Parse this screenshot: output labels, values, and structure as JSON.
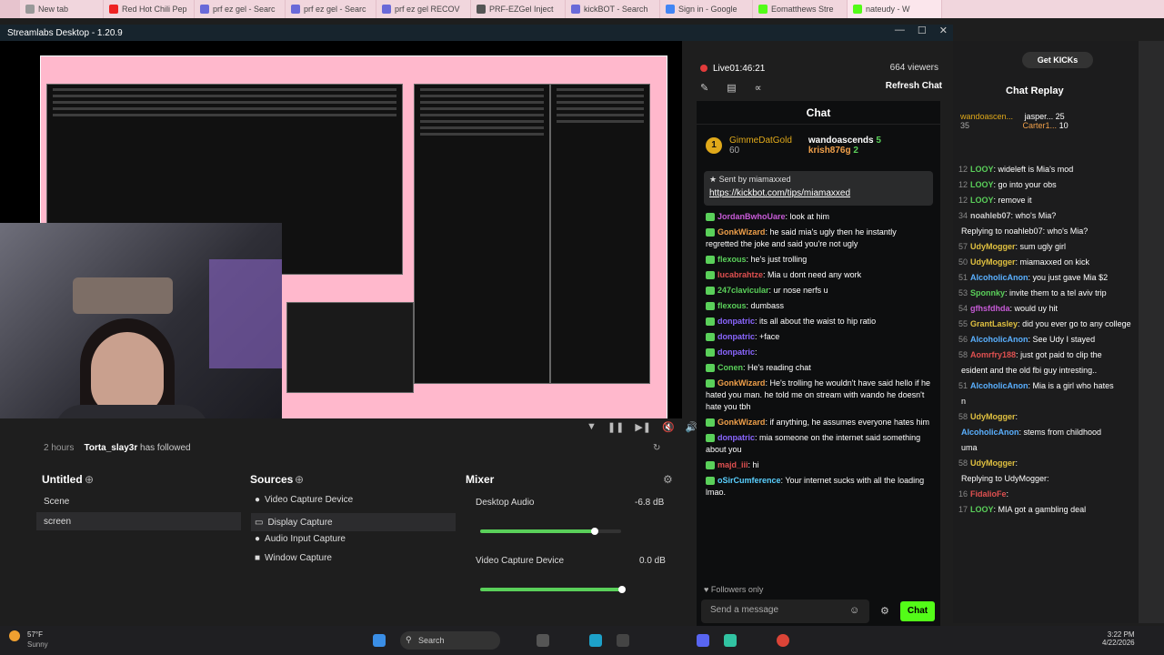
{
  "browser_tabs": [
    "New tab",
    "Red Hot Chili Pep",
    "prf ez gel - Searc",
    "prf ez gel - Searc",
    "prf ez gel RECOV",
    "PRF-EZGel Inject",
    "kickBOT - Search",
    "Sign in - Google",
    "Eomatthews Stre",
    "nateudy - W"
  ],
  "obs": {
    "title": "Streamlabs Desktop - 1.20.9",
    "live_time": "Live01:46:21",
    "viewers": "664 viewers",
    "refresh_chat": "Refresh Chat",
    "activity": {
      "time": "2 hours",
      "user": "Torta_slay3r",
      "action": "has followed"
    },
    "scenes": {
      "title": "Untitled",
      "items": [
        "Scene",
        "screen"
      ]
    },
    "sources": {
      "title": "Sources",
      "items": [
        "Video Capture Device",
        "Display Capture",
        "Audio Input Capture",
        "Window Capture"
      ]
    },
    "mixer": {
      "title": "Mixer",
      "items": [
        {
          "name": "Desktop Audio",
          "level": "-6.8 dB"
        },
        {
          "name": "Video Capture Device",
          "level": "0.0 dB"
        }
      ]
    }
  },
  "chat": {
    "header": "Chat",
    "gifters": [
      {
        "name": "GimmeDatGold",
        "count": "60"
      },
      {
        "name": "wandoascends",
        "count": "5"
      },
      {
        "name": "krish876g",
        "count": "2"
      }
    ],
    "pinned": {
      "sent_by_label": "Sent by",
      "sender": "miamaxxed",
      "link": "https://kickbot.com/tips/miamaxxed"
    },
    "messages": [
      {
        "user": "JordanBwhoUare",
        "color": "#c85bd8",
        "text": "look at him"
      },
      {
        "user": "GonkWizard",
        "color": "#f0a04a",
        "text": "he said mia's ugly then he instantly regretted the joke and said you're not ugly"
      },
      {
        "user": "flexous",
        "color": "#5ad05a",
        "text": "he's just trolling"
      },
      {
        "user": "lucabrahtze",
        "color": "#e05050",
        "text": "Mia u dont need any work"
      },
      {
        "user": "247clavicular",
        "color": "#5ad05a",
        "text": "ur nose nerfs u"
      },
      {
        "user": "flexous",
        "color": "#5ad05a",
        "text": "dumbass"
      },
      {
        "user": "donpatric",
        "color": "#8a66ff",
        "text": "its all about the waist to hip ratio"
      },
      {
        "user": "donpatric",
        "color": "#8a66ff",
        "text": "+face"
      },
      {
        "user": "donpatric",
        "color": "#8a66ff",
        "text": ""
      },
      {
        "user": "Conen",
        "color": "#5ad05a",
        "text": "He's reading chat"
      },
      {
        "user": "GonkWizard",
        "color": "#f0a04a",
        "text": "He's trolling he wouldn't have said hello if he hated you man. he told me on stream with wando he doesn't hate you tbh"
      },
      {
        "user": "GonkWizard",
        "color": "#f0a04a",
        "text": "if anything, he assumes everyone hates him"
      },
      {
        "user": "donpatric",
        "color": "#8a66ff",
        "text": "mia someone on the internet said something about you"
      },
      {
        "user": "majd_iii",
        "color": "#e05050",
        "text": "hi"
      },
      {
        "user": "oSirCumference",
        "color": "#5ad0ff",
        "text": "Your internet sucks with all the loading lmao."
      }
    ],
    "followers_only": "Followers only",
    "input_placeholder": "Send a message",
    "send_label": "Chat"
  },
  "kick": {
    "get_kicks": "Get KICKs",
    "replay_title": "Chat Replay",
    "top": [
      {
        "name": "wandoascen...",
        "count": "35"
      },
      {
        "name": "jasper...",
        "count": "25"
      },
      {
        "name": "Carter1...",
        "count": "10"
      }
    ],
    "messages": [
      {
        "t": "12",
        "user": "LOOY",
        "color": "#5ad05a",
        "text": "wideleft is Mia's mod"
      },
      {
        "t": "12",
        "user": "LOOY",
        "color": "#5ad05a",
        "text": "go into your obs"
      },
      {
        "t": "12",
        "user": "LOOY",
        "color": "#5ad05a",
        "text": "remove it"
      },
      {
        "t": "34",
        "user": "noahleb07",
        "color": "#cccccc",
        "text": "who's Mia?"
      },
      {
        "t": "",
        "user": "",
        "color": "#888",
        "text": "Replying to noahleb07: who's Mia?"
      },
      {
        "t": "57",
        "user": "UdyMogger",
        "color": "#e0c040",
        "text": "sum ugly girl"
      },
      {
        "t": "50",
        "user": "UdyMogger",
        "color": "#e0c040",
        "text": "miamaxxed on kick"
      },
      {
        "t": "51",
        "user": "AlcoholicAnon",
        "color": "#5ab0ff",
        "text": "you just gave Mia $2"
      },
      {
        "t": "53",
        "user": "Sponnky",
        "color": "#5ad05a",
        "text": "invite them to a tel aviv trip"
      },
      {
        "t": "54",
        "user": "gfhsfdhda",
        "color": "#c85bd8",
        "text": "would uy hit"
      },
      {
        "t": "55",
        "user": "GrantLasley",
        "color": "#e0c040",
        "text": "did you ever go to any college"
      },
      {
        "t": "56",
        "user": "AlcoholicAnon",
        "color": "#5ab0ff",
        "text": "See Udy I stayed"
      },
      {
        "t": "58",
        "user": "Aomrfry188",
        "color": "#e05050",
        "text": "just got paid to clip the"
      },
      {
        "t": "",
        "user": "",
        "color": "#fff",
        "text": "esident and the old fbi guy intresting.."
      },
      {
        "t": "51",
        "user": "AlcoholicAnon",
        "color": "#5ab0ff",
        "text": "Mia is a girl who hates"
      },
      {
        "t": "",
        "user": "",
        "color": "#fff",
        "text": "n"
      },
      {
        "t": "58",
        "user": "UdyMogger",
        "color": "#e0c040",
        "text": ""
      },
      {
        "t": "",
        "user": "AlcoholicAnon",
        "color": "#5ab0ff",
        "text": "stems from childhood"
      },
      {
        "t": "",
        "user": "",
        "color": "#fff",
        "text": "uma"
      },
      {
        "t": "58",
        "user": "UdyMogger",
        "color": "#e0c040",
        "text": ""
      },
      {
        "t": "",
        "user": "",
        "color": "#888",
        "text": "Replying to UdyMogger:"
      },
      {
        "t": "16",
        "user": "FidalioFe",
        "color": "#e05050",
        "text": ""
      },
      {
        "t": "17",
        "user": "LOOY",
        "color": "#5ad05a",
        "text": "MIA got a gambling deal"
      }
    ]
  },
  "taskbar": {
    "weather_temp": "57°F",
    "weather_desc": "Sunny",
    "search": "Search",
    "time": "3:22 PM",
    "date": "4/22/2026"
  }
}
